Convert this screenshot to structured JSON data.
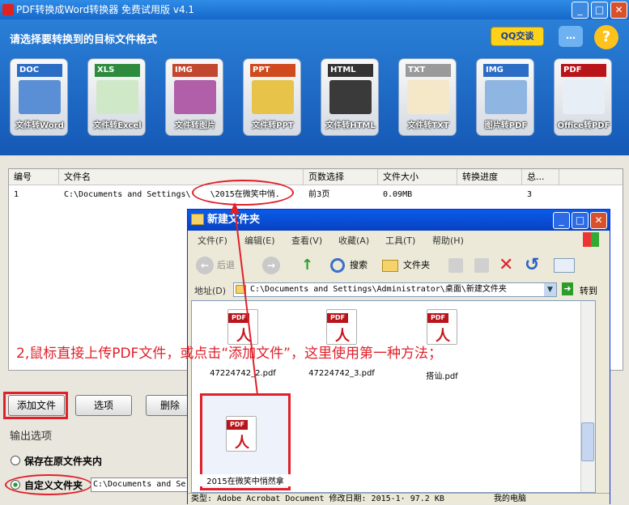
{
  "window": {
    "title": "PDF转换成Word转换器 免费试用版 v4.1",
    "minimize": "_",
    "maximize": "□",
    "close": "✕"
  },
  "header": {
    "prompt": "请选择要转换到的目标文件格式",
    "qq_button": "QQ交谈",
    "chat_icon": "…",
    "help_icon": "?"
  },
  "tiles": [
    {
      "tag": "DOC",
      "label": "文件转Word",
      "tag_color": "#2b6cc4",
      "pic_color": "#5a8fd6"
    },
    {
      "tag": "XLS",
      "label": "文件转Excel",
      "tag_color": "#2e8b3d",
      "pic_color": "#cfe8c8"
    },
    {
      "tag": "IMG",
      "label": "文件转图片",
      "tag_color": "#c2472f",
      "pic_color": "#b05fa8"
    },
    {
      "tag": "PPT",
      "label": "文件转PPT",
      "tag_color": "#cf4a1d",
      "pic_color": "#e8c34a"
    },
    {
      "tag": "HTML",
      "label": "文件转HTML",
      "tag_color": "#333333",
      "pic_color": "#3a3a3a"
    },
    {
      "tag": "TXT",
      "label": "文件转TXT",
      "tag_color": "#9a9a9a",
      "pic_color": "#f4e8c8"
    },
    {
      "tag": "IMG",
      "label": "图片转PDF",
      "tag_color": "#2b6cc4",
      "pic_color": "#8fb6e2"
    },
    {
      "tag": "PDF",
      "label": "Office转PDF",
      "tag_color": "#b8141a",
      "pic_color": "#e8eef6"
    }
  ],
  "table": {
    "headers": [
      "编号",
      "文件名",
      "页数选择",
      "文件大小",
      "转换进度",
      "总..."
    ],
    "rows": [
      {
        "num": "1",
        "filename": "C:\\Documents and Settings\\    \\2015在微笑中悄.",
        "pages": "前3页",
        "size": "0.09MB",
        "progress": "",
        "total": "3"
      }
    ]
  },
  "buttons": {
    "add_file": "添加文件",
    "options": "选项",
    "delete": "删除"
  },
  "output": {
    "title": "输出选项",
    "option_original": "保存在原文件夹内",
    "option_custom": "自定义文件夹",
    "custom_path": "C:\\Documents and Se"
  },
  "instruction": "2,鼠标直接上传PDF文件，或点击“添加文件”，这里使用第一种方法；",
  "explorer": {
    "title": "新建文件夹",
    "menu": [
      "文件(F)",
      "编辑(E)",
      "查看(V)",
      "收藏(A)",
      "工具(T)",
      "帮助(H)"
    ],
    "toolbar": {
      "back": "后退",
      "search": "搜索",
      "folders": "文件夹"
    },
    "address_label": "地址(D)",
    "address": "C:\\Documents and Settings\\Administrator\\桌面\\新建文件夹",
    "go": "转到",
    "files": [
      "47224742_2.pdf",
      "47224742_3.pdf",
      "搭讪.pdf",
      "2015在微笑中悄然拿"
    ],
    "status_left": "类型: Adobe Acrobat Document 修改日期: 2015-1· 97.2 KB",
    "status_right": "我的电脑"
  }
}
